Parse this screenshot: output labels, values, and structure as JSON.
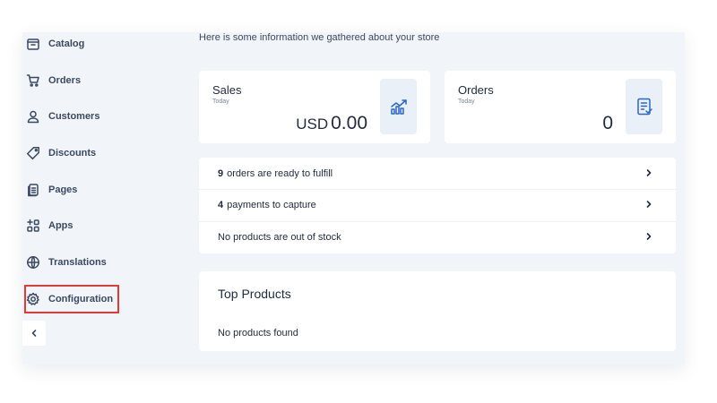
{
  "intro_text": "Here is some information we gathered about your store",
  "sidebar": {
    "items": [
      {
        "label": "Catalog",
        "icon": "catalog-icon"
      },
      {
        "label": "Orders",
        "icon": "cart-icon"
      },
      {
        "label": "Customers",
        "icon": "user-icon"
      },
      {
        "label": "Discounts",
        "icon": "tag-icon"
      },
      {
        "label": "Pages",
        "icon": "pages-icon"
      },
      {
        "label": "Apps",
        "icon": "apps-icon"
      },
      {
        "label": "Translations",
        "icon": "globe-icon"
      },
      {
        "label": "Configuration",
        "icon": "gear-icon"
      }
    ],
    "collapse_icon": "chevron-left-icon"
  },
  "stats": {
    "sales": {
      "title": "Sales",
      "period": "Today",
      "currency": "USD",
      "value": "0.00",
      "icon": "chart-trend-icon"
    },
    "orders": {
      "title": "Orders",
      "period": "Today",
      "value": "0",
      "icon": "orders-checklist-icon"
    }
  },
  "tasks": [
    {
      "count": "9",
      "text": "orders are ready to fulfill"
    },
    {
      "count": "4",
      "text": "payments to capture"
    },
    {
      "count": "",
      "text": "No products are out of stock"
    }
  ],
  "top_products": {
    "title": "Top Products",
    "empty_text": "No products found"
  },
  "colors": {
    "highlight_border": "#e53935",
    "accent": "#2a66c8",
    "background": "#f1f4f8"
  }
}
